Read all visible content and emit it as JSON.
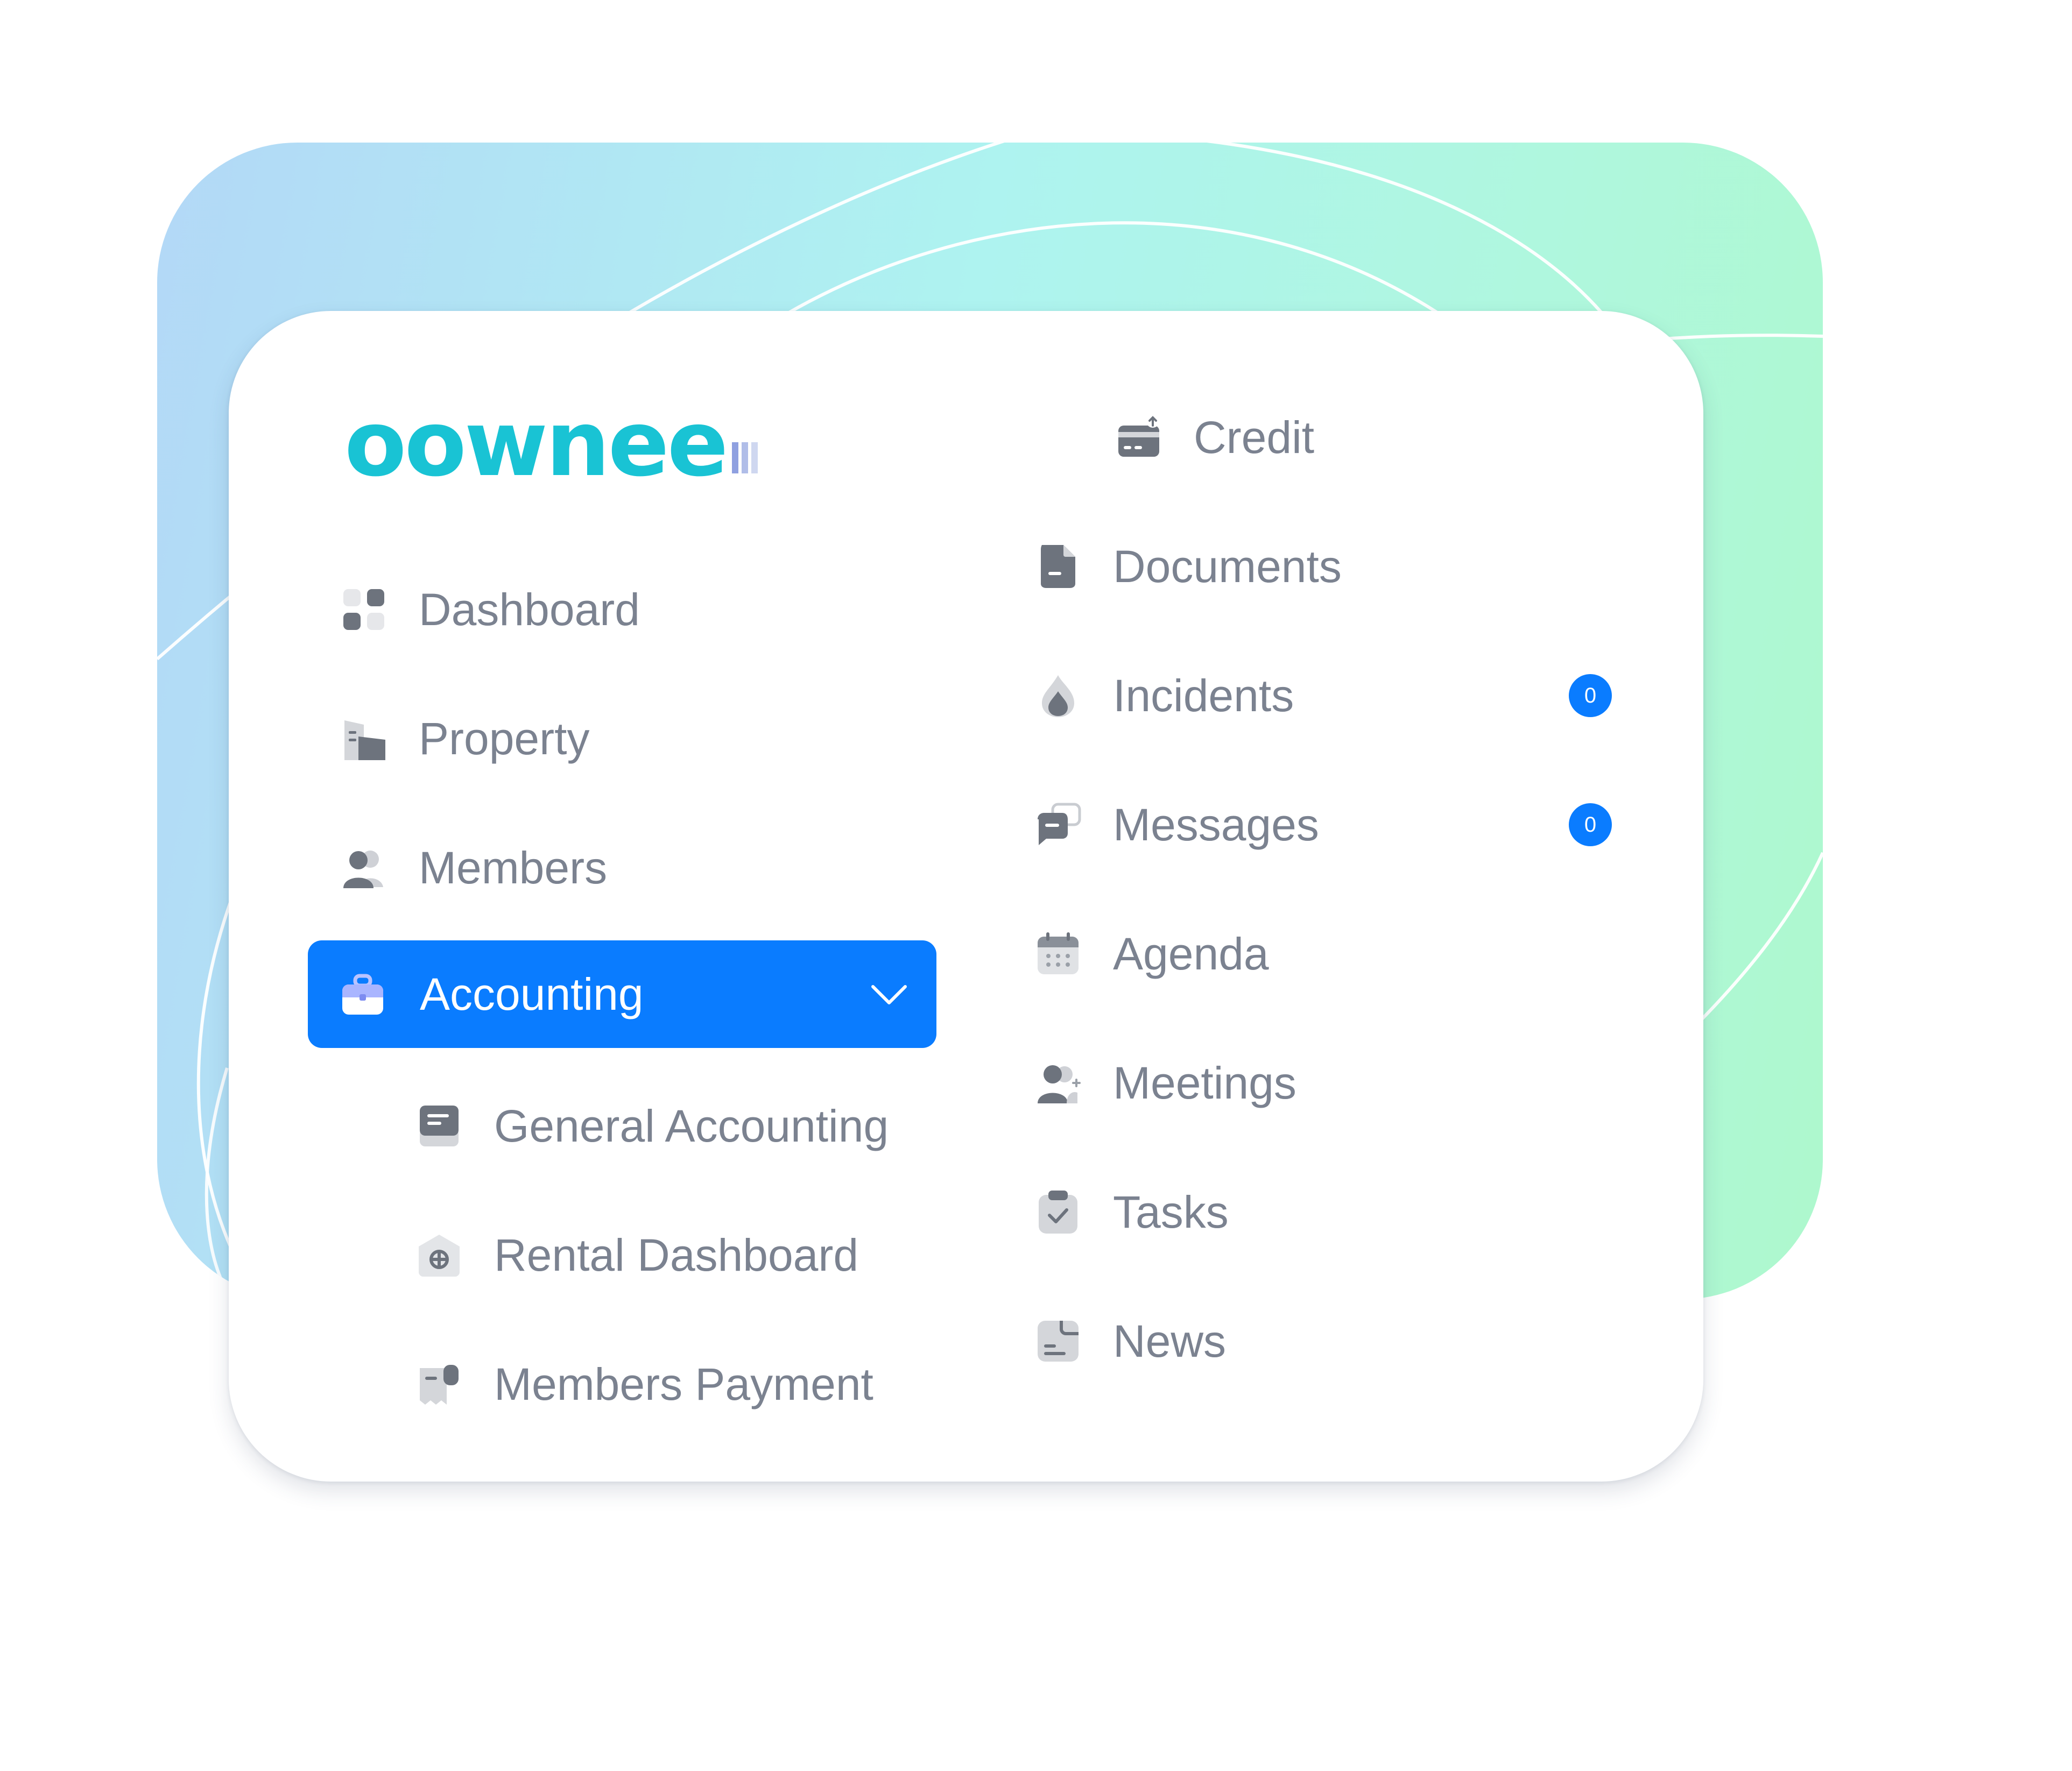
{
  "brand": {
    "logo_text": "oownee",
    "bar_colors": [
      "#8fa0e0",
      "#b0bde8",
      "#cfd7f0"
    ]
  },
  "left_menu": {
    "items": [
      {
        "label": "Dashboard",
        "icon": "dashboard-grid-icon"
      },
      {
        "label": "Property",
        "icon": "building-icon"
      },
      {
        "label": "Members",
        "icon": "members-icon"
      }
    ],
    "active": {
      "label": "Accounting",
      "icon": "briefcase-icon",
      "expanded": true,
      "color": "#0a7cff"
    },
    "sub_items": [
      {
        "label": "General Accounting",
        "icon": "ledger-icon"
      },
      {
        "label": "Rental Dashboard",
        "icon": "rental-house-icon"
      },
      {
        "label": "Members Payment",
        "icon": "receipt-icon"
      }
    ]
  },
  "right_menu": {
    "items": [
      {
        "label": "Credit",
        "icon": "credit-card-icon"
      },
      {
        "label": "Documents",
        "icon": "document-icon"
      },
      {
        "label": "Incidents",
        "icon": "fire-icon",
        "badge": "0"
      },
      {
        "label": "Messages",
        "icon": "chat-icon",
        "badge": "0"
      },
      {
        "label": "Agenda",
        "icon": "calendar-icon"
      },
      {
        "label": "Meetings",
        "icon": "meeting-icon"
      },
      {
        "label": "Tasks",
        "icon": "clipboard-check-icon"
      },
      {
        "label": "News",
        "icon": "news-icon"
      }
    ]
  },
  "colors": {
    "accent": "#0a7cff",
    "text": "#7b8290",
    "logo": "#19c3d4"
  }
}
